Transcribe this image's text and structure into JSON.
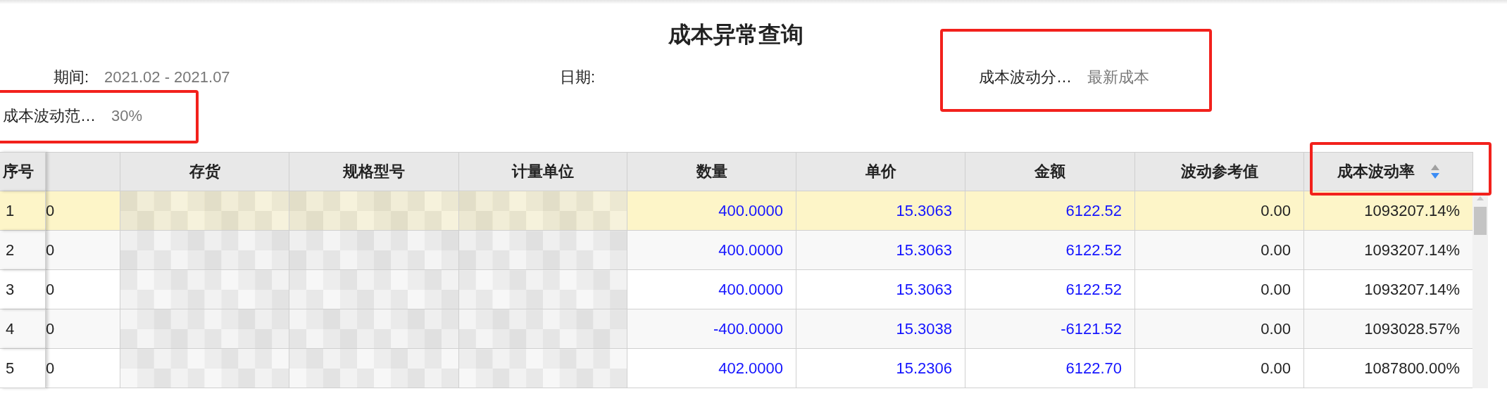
{
  "title": "成本异常查询",
  "filters": {
    "period": {
      "label": "期间:",
      "value": "2021.02 - 2021.07"
    },
    "date": {
      "label": "日期:"
    },
    "basis": {
      "label": "成本波动分…",
      "value": "最新成本"
    },
    "range": {
      "label": "成本波动范…",
      "value": "30%"
    }
  },
  "table": {
    "columns": [
      {
        "label": "序号"
      },
      {},
      {
        "label": "存货"
      },
      {
        "label": "规格型号"
      },
      {
        "label": "计量单位"
      },
      {
        "label": "数量"
      },
      {
        "label": "单价"
      },
      {
        "label": "金额"
      },
      {
        "label": "波动参考值"
      },
      {
        "label": "成本波动率",
        "sorted_descending": true
      }
    ],
    "rows": [
      {
        "selected": true,
        "cells": [
          "1",
          "0",
          null,
          null,
          null,
          "400.0000",
          "15.3063",
          "6122.52",
          "0.00",
          "1093207.14%"
        ]
      },
      {
        "selected": false,
        "cells": [
          "2",
          "0",
          null,
          null,
          null,
          "400.0000",
          "15.3063",
          "6122.52",
          "0.00",
          "1093207.14%"
        ]
      },
      {
        "selected": false,
        "cells": [
          "3",
          "0",
          null,
          null,
          null,
          "400.0000",
          "15.3063",
          "6122.52",
          "0.00",
          "1093207.14%"
        ]
      },
      {
        "selected": false,
        "cells": [
          "4",
          "0",
          null,
          null,
          null,
          "-400.0000",
          "15.3038",
          "-6121.52",
          "0.00",
          "1093028.57%"
        ]
      },
      {
        "selected": false,
        "cells": [
          "5",
          "0",
          null,
          null,
          null,
          "402.0000",
          "15.2306",
          "6122.70",
          "0.00",
          "1087800.00%"
        ]
      }
    ]
  }
}
